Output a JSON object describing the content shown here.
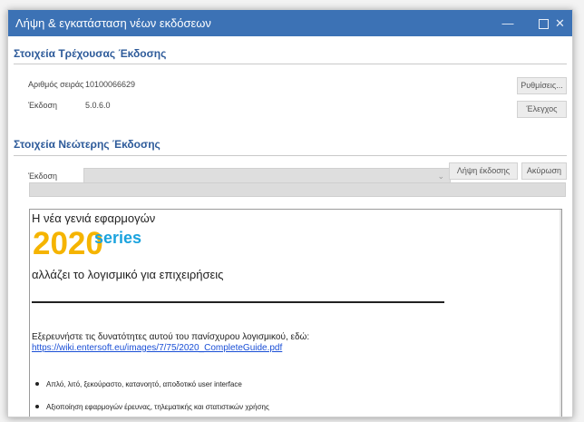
{
  "window": {
    "title": "Λήψη & εγκατάσταση νέων εκδόσεων",
    "min_glyph": "—",
    "close_glyph": "✕"
  },
  "current": {
    "section_title": "Στοιχεία Τρέχουσας Έκδοσης",
    "serial_label": "Αριθμός σειράς",
    "serial_value": "10100066629",
    "version_label": "Έκδοση",
    "version_value": "5.0.6.0",
    "settings_button": "Ρυθμίσεις...",
    "check_button": "Έλεγχος"
  },
  "newer": {
    "section_title": "Στοιχεία Νεώτερης Έκδοσης",
    "version_label": "Έκδοση",
    "version_select_value": "",
    "download_button": "Λήψη έκδοσης",
    "cancel_button": "Ακύρωση",
    "progress": 0
  },
  "content": {
    "heading": "Η νέα γενιά εφαρμογών",
    "brand_number": "2020",
    "brand_word": "series",
    "tagline": "αλλάζει το λογισμικό για επιχειρήσεις",
    "explore_text": "Εξερευνήστε τις δυνατότητες αυτού του πανίσχυρου λογισμικού, εδώ:",
    "link": "https://wiki.entersoft.eu/images/7/75/2020_CompleteGuide.pdf",
    "bullets": [
      "Απλό, λιτό, ξεκούραστο, κατανοητό, αποδοτικό user interface",
      "Αξιοποίηση εφαρμογών έρευνας, τηλεματικής και στατιστικών χρήσης"
    ]
  },
  "colors": {
    "titlebar": "#3c72b5",
    "section": "#2e5b9a",
    "brand_yellow": "#f5b400",
    "brand_blue": "#1aa3de",
    "link": "#1a4fd6"
  }
}
